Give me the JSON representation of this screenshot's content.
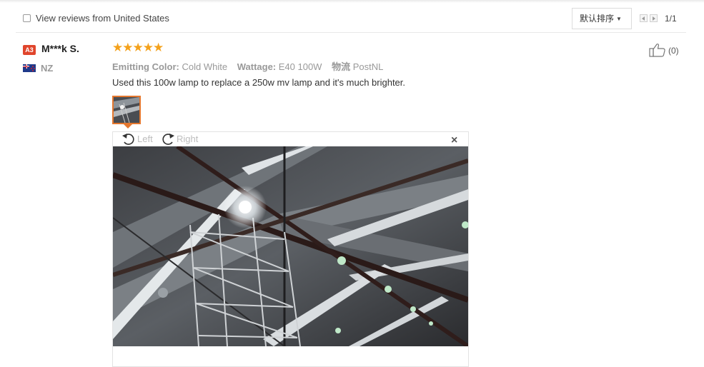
{
  "filter": {
    "checkbox_label": "View reviews from United States",
    "sort_label": "默认排序",
    "pager_text": "1/1"
  },
  "review": {
    "level_badge": "A3",
    "reviewer": "M***k S.",
    "country": "NZ",
    "rating_stars": 5,
    "sku": [
      {
        "label": "Emitting Color:",
        "value": "Cold White"
      },
      {
        "label": "Wattage:",
        "value": "E40 100W"
      },
      {
        "label": "物流",
        "value": "PostNL"
      }
    ],
    "text": "Used this 100w lamp to replace a 250w mv lamp and it's much brighter.",
    "helpful_count": "(0)"
  },
  "viewer": {
    "rotate_left": "Left",
    "rotate_right": "Right",
    "close": "×"
  },
  "colors": {
    "accent_orange": "#e4772e",
    "star": "#f4a11b",
    "badge": "#e0452c"
  }
}
